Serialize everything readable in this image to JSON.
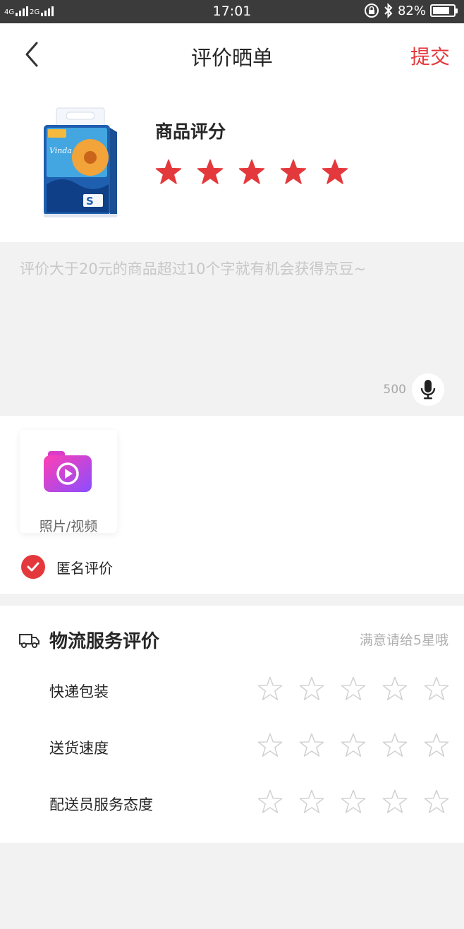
{
  "status_bar": {
    "network_1": "4G",
    "network_2": "2G",
    "time": "17:01",
    "battery_text": "82%",
    "battery_level": 0.82
  },
  "nav": {
    "title": "评价晒单",
    "submit_label": "提交",
    "back_icon": "chevron-left-icon"
  },
  "product": {
    "rating_title": "商品评分",
    "rating": 5,
    "max_rating": 5,
    "star_color": "#e4393c"
  },
  "review": {
    "placeholder": "评价大于20元的商品超过10个字就有机会获得京豆~",
    "char_limit": "500",
    "mic_icon": "microphone-icon"
  },
  "media": {
    "upload_label": "照片/视频",
    "anonymous_label": "匿名评价",
    "anonymous_checked": true
  },
  "logistics": {
    "title": "物流服务评价",
    "hint": "满意请给5星哦",
    "items": [
      {
        "label": "快递包装",
        "rating": 0
      },
      {
        "label": "送货速度",
        "rating": 0
      },
      {
        "label": "配送员服务态度",
        "rating": 0
      }
    ]
  },
  "colors": {
    "accent": "#e4393c",
    "placeholder": "#c8c8c8",
    "background": "#f2f2f2"
  }
}
